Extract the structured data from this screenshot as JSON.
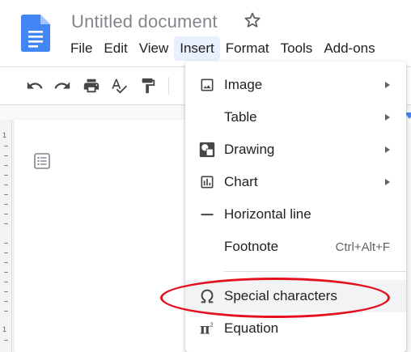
{
  "document": {
    "title": "Untitled document"
  },
  "menubar": {
    "items": [
      {
        "label": "File"
      },
      {
        "label": "Edit"
      },
      {
        "label": "View"
      },
      {
        "label": "Insert"
      },
      {
        "label": "Format"
      },
      {
        "label": "Tools"
      },
      {
        "label": "Add-ons"
      }
    ],
    "active_item": "Insert"
  },
  "toolbar": {
    "buttons": [
      "undo-icon",
      "redo-icon",
      "print-icon",
      "spellcheck-icon",
      "paint-format-icon"
    ]
  },
  "ruler": {
    "numbers": [
      "1",
      "1"
    ]
  },
  "insert_menu": {
    "items": [
      {
        "label": "Image",
        "icon": "image-icon",
        "submenu": true
      },
      {
        "label": "Table",
        "icon": "",
        "submenu": true
      },
      {
        "label": "Drawing",
        "icon": "drawing-icon",
        "submenu": true
      },
      {
        "label": "Chart",
        "icon": "chart-icon",
        "submenu": true
      },
      {
        "label": "Horizontal line",
        "icon": "horizontal-line-icon",
        "submenu": false
      },
      {
        "label": "Footnote",
        "icon": "",
        "shortcut": "Ctrl+Alt+F",
        "submenu": false
      },
      {
        "label": "Special characters",
        "icon": "omega-icon",
        "submenu": false,
        "highlighted": true,
        "annotated": true
      },
      {
        "label": "Equation",
        "icon": "pi-icon",
        "submenu": false
      }
    ]
  },
  "colors": {
    "brand_blue": "#4285f4",
    "annotation_red": "#e5101d",
    "active_menu_bg": "#e8f0fe",
    "title_gray": "#80868b"
  }
}
